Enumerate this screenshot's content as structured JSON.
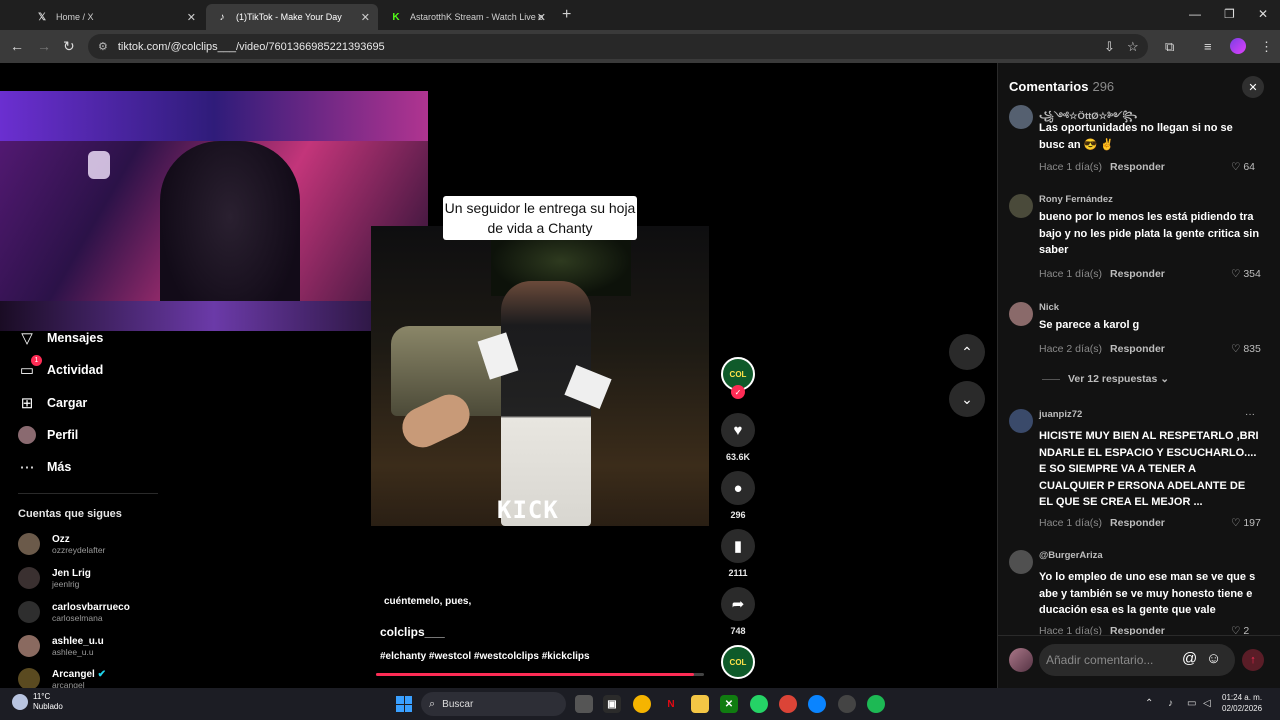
{
  "browser": {
    "tabs": [
      {
        "title": "Home / X",
        "icon": "x-logo-icon"
      },
      {
        "title": "(1)TikTok - Make Your Day",
        "icon": "tiktok-logo-icon"
      },
      {
        "title": "AstarotthK Stream - Watch Live o",
        "icon": "kick-logo-icon"
      }
    ],
    "url": "tiktok.com/@colclips___/video/7601366985221393695"
  },
  "sidebar": {
    "items": [
      {
        "label": "Mensajes",
        "icon": "send-icon"
      },
      {
        "label": "Actividad",
        "icon": "activity-icon",
        "badge": "1"
      },
      {
        "label": "Cargar",
        "icon": "upload-icon"
      },
      {
        "label": "Perfil",
        "icon": "profile-avatar-icon"
      },
      {
        "label": "Más",
        "icon": "more-dots-icon"
      }
    ],
    "following_title": "Cuentas que sigues",
    "following": [
      {
        "name": "Ozz",
        "handle": "ozzreydelafter",
        "color": "#6b5a4a"
      },
      {
        "name": "Jen Lrig",
        "handle": "jeenlrig",
        "color": "#3a3030"
      },
      {
        "name": "carlosvbarrueco",
        "handle": "carloselmana",
        "color": "#2e2e2e"
      },
      {
        "name": "ashlee_u.u",
        "handle": "ashlee_u.u",
        "color": "#8a6a60"
      },
      {
        "name": "Arcangel",
        "handle": "arcangel",
        "color": "#5a4a20"
      }
    ]
  },
  "video": {
    "caption_overlay": "Un seguidor le entrega su hoja de vida a Chanty",
    "watermark": "KICK",
    "description": "cuéntemelo, pues,",
    "author": "colclips___",
    "hashtags": "#elchanty #westcol #westcolclips #kickclips",
    "progress": 0.97
  },
  "actions": {
    "avatar_text": "COL",
    "likes": "63.6K",
    "comments": "296",
    "saves": "2111",
    "shares": "748"
  },
  "comments_panel": {
    "title": "Comentarios",
    "count": "296",
    "items": [
      {
        "user": "꧁༺☆ÖttØ☆༻꧂",
        "text": "Las oportunidades no llegan si no se busc an 😎 ✌",
        "time": "Hace 1 día(s)",
        "reply": "Responder",
        "likes": "64",
        "avatar_color": "#556070"
      },
      {
        "user": "Rony Fernández",
        "text": "bueno por lo menos les está pidiendo tra bajo y no les pide plata la gente critica sin saber",
        "time": "Hace 1 día(s)",
        "reply": "Responder",
        "likes": "354",
        "avatar_color": "#4a4a3a"
      },
      {
        "user": "Nick",
        "text": "Se parece a karol g",
        "time": "Hace 2 día(s)",
        "reply": "Responder",
        "likes": "835",
        "avatar_color": "#8a6a6a"
      },
      {
        "user": "juanpiz72",
        "text": "HICISTE MUY BIEN AL RESPETARLO ,BRI NDARLE EL ESPACIO Y ESCUCHARLO.... E SO SIEMPRE VA A TENER A CUALQUIER P ERSONA ADELANTE DE EL QUE SE CREA EL MEJOR ...",
        "time": "Hace 1 día(s)",
        "reply": "Responder",
        "likes": "197",
        "avatar_color": "#3a4a6a"
      },
      {
        "user": "@BurgerAriza",
        "text": "Yo lo empleo de uno ese man se ve que s abe y también se ve muy honesto tiene e ducación esa es la gente que vale",
        "time": "Hace 1 día(s)",
        "reply": "Responder",
        "likes": "2",
        "avatar_color": "#505050"
      }
    ],
    "view_replies": "Ver 12 respuestas",
    "input_placeholder": "Añadir comentario..."
  },
  "taskbar": {
    "weather_temp": "11°C",
    "weather_desc": "Nublado",
    "search_label": "Buscar",
    "time": "01:24 a. m.",
    "date": "02/02/2026"
  }
}
